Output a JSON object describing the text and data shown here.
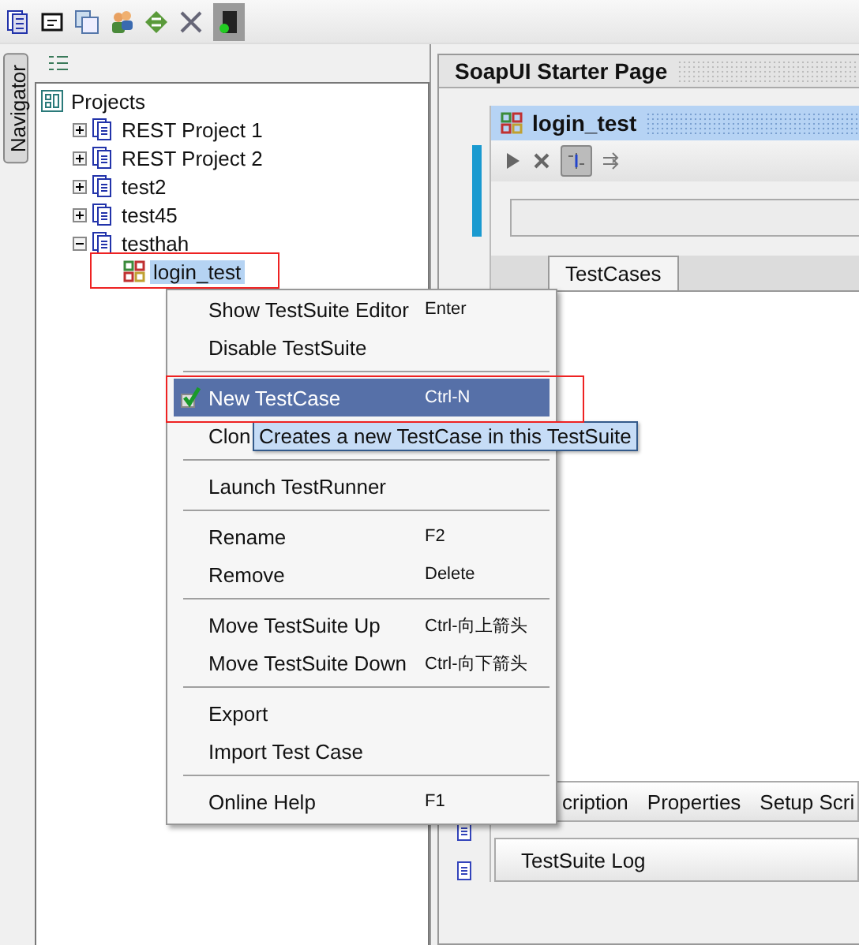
{
  "navigator": {
    "tab_label": "Navigator",
    "tree": [
      {
        "label": "Projects",
        "children": [
          {
            "label": "REST Project 1",
            "expanded": false
          },
          {
            "label": "REST Project 2",
            "expanded": false
          },
          {
            "label": "test2",
            "expanded": false
          },
          {
            "label": "test45",
            "expanded": false
          },
          {
            "label": "testhah",
            "expanded": true,
            "children": [
              {
                "label": "login_test",
                "selected": true
              }
            ]
          }
        ]
      }
    ]
  },
  "editor": {
    "tab_title": "SoapUI Starter Page",
    "suite_window": {
      "title": "login_test",
      "tabs": [
        {
          "label": "TestCases",
          "selected": true
        }
      ],
      "bottom_tabs": [
        {
          "label": "cription"
        },
        {
          "label": "Properties"
        },
        {
          "label": "Setup Scri"
        }
      ],
      "log_label": "TestSuite Log"
    }
  },
  "context_menu": {
    "items": [
      {
        "kind": "action",
        "label": "Show TestSuite Editor",
        "shortcut": "Enter",
        "selected": false
      },
      {
        "kind": "action",
        "label": "Disable TestSuite",
        "selected": false
      },
      {
        "kind": "separator"
      },
      {
        "kind": "icon_action",
        "label": "New TestCase",
        "shortcut": "Ctrl-N",
        "selected": true
      },
      {
        "kind": "action",
        "label": "Clon",
        "selected": false
      },
      {
        "kind": "separator"
      },
      {
        "kind": "action",
        "label": "Launch TestRunner",
        "selected": false
      },
      {
        "kind": "separator"
      },
      {
        "kind": "action",
        "label": "Rename",
        "shortcut": "F2",
        "selected": false
      },
      {
        "kind": "action",
        "label": "Remove",
        "shortcut": "Delete",
        "selected": false
      },
      {
        "kind": "separator"
      },
      {
        "kind": "action",
        "label": "Move TestSuite Up",
        "shortcut": "Ctrl-向上箭头",
        "selected": false
      },
      {
        "kind": "action",
        "label": "Move TestSuite Down",
        "shortcut": "Ctrl-向下箭头",
        "selected": false
      },
      {
        "kind": "separator"
      },
      {
        "kind": "action",
        "label": "Export",
        "selected": false
      },
      {
        "kind": "action",
        "label": "Import Test Case",
        "selected": false
      },
      {
        "kind": "separator"
      },
      {
        "kind": "action",
        "label": "Online Help",
        "shortcut": "F1",
        "selected": false
      }
    ]
  },
  "tooltip": "Creates a new TestCase in this TestSuite"
}
